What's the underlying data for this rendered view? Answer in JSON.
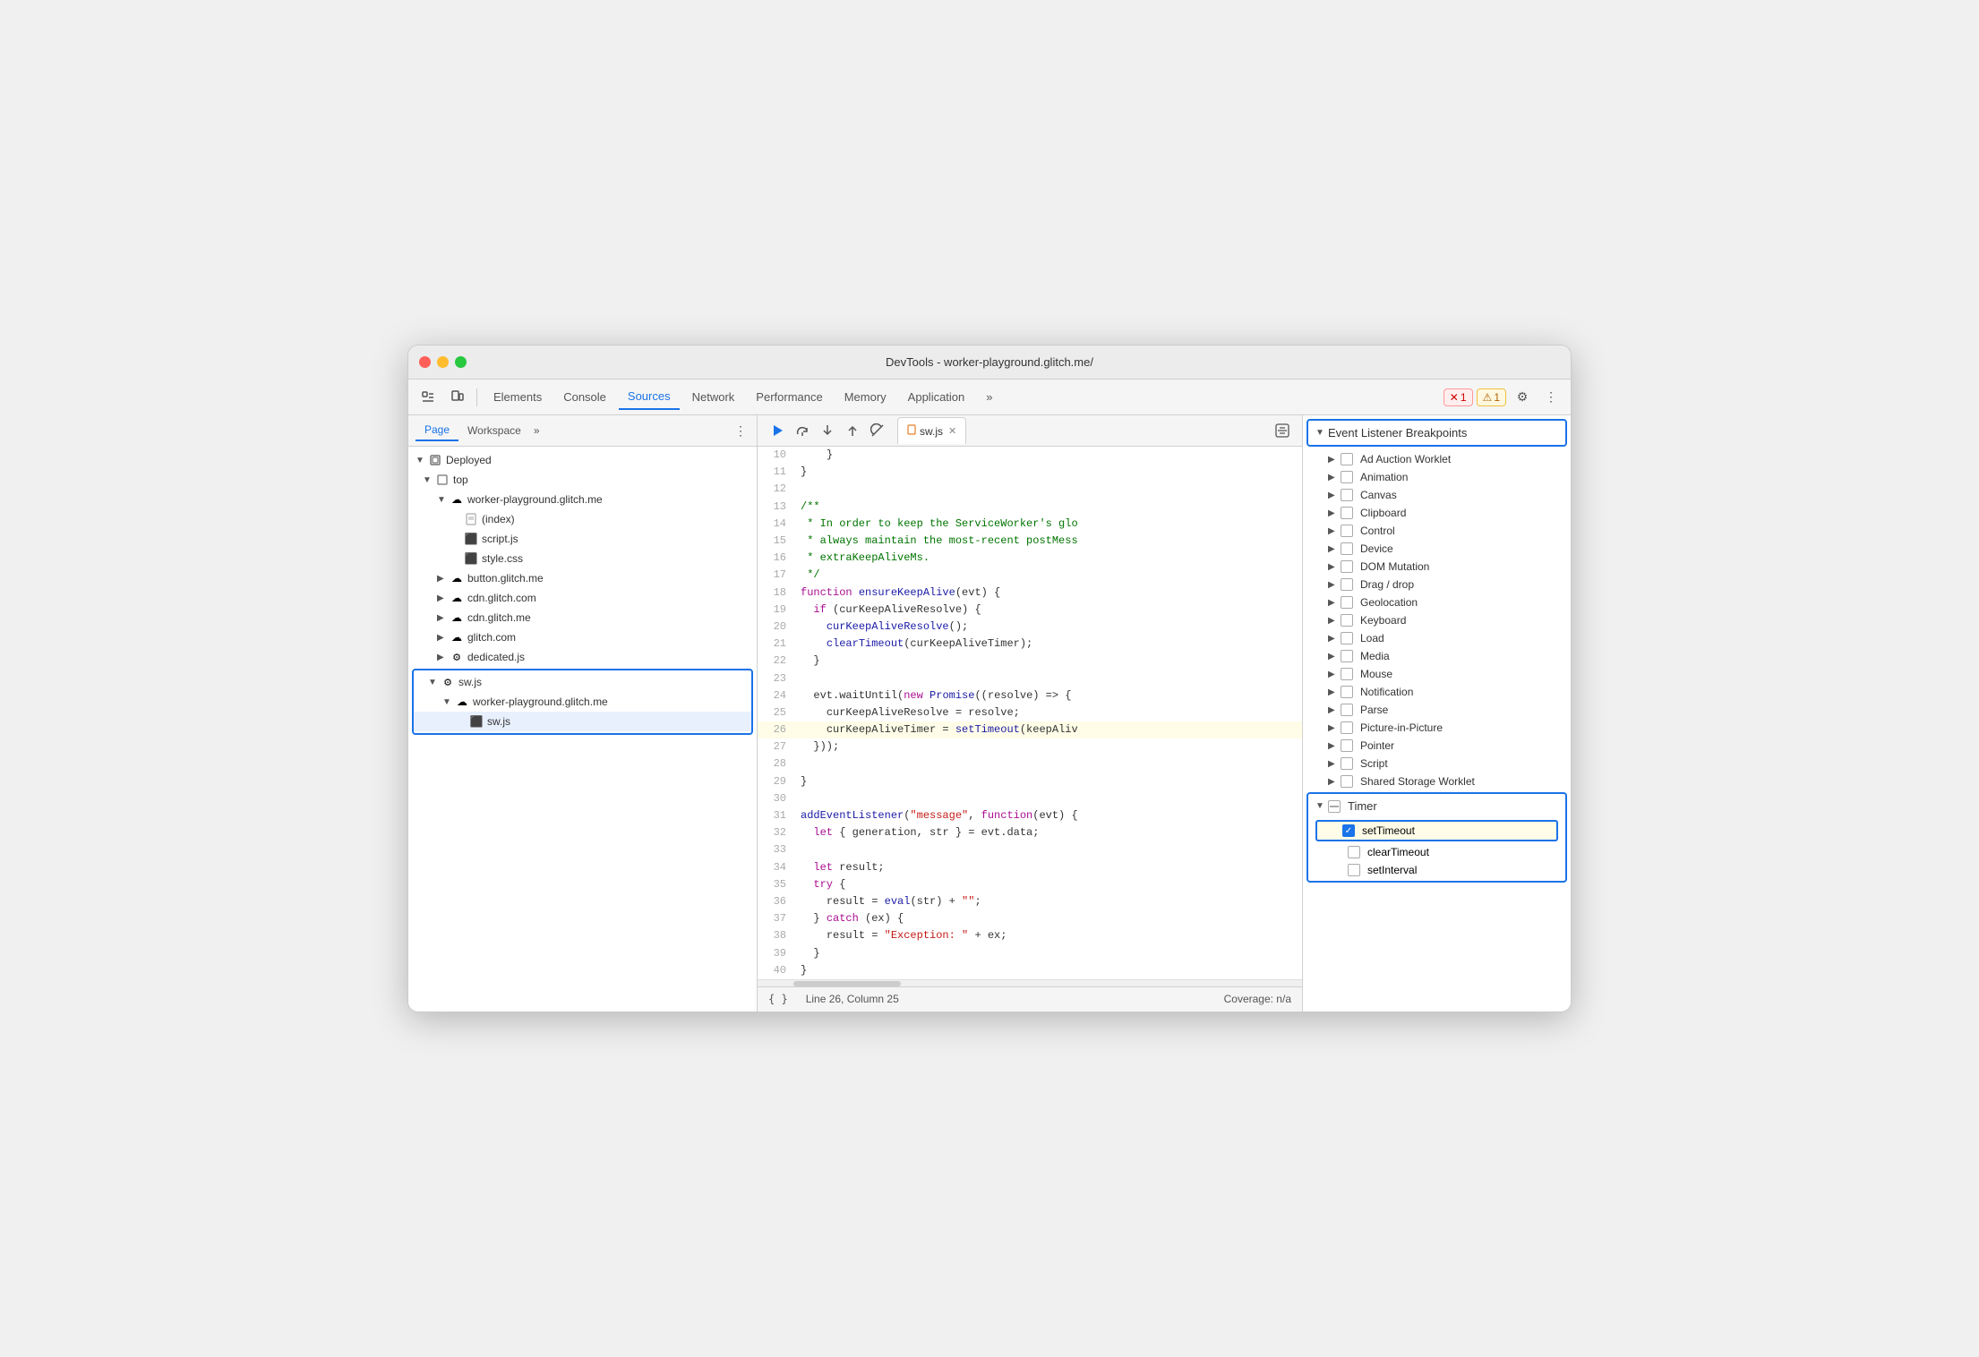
{
  "window": {
    "title": "DevTools - worker-playground.glitch.me/"
  },
  "toolbar": {
    "tabs": [
      "Elements",
      "Console",
      "Sources",
      "Network",
      "Performance",
      "Memory",
      "Application"
    ],
    "active_tab": "Sources",
    "more_icon": "»",
    "error_count": "1",
    "warn_count": "1"
  },
  "left_panel": {
    "tabs": [
      "Page",
      "Workspace"
    ],
    "more": "»",
    "active_tab": "Page",
    "tree": [
      {
        "label": "Deployed",
        "indent": 0,
        "arrow": "▼",
        "icon": "cube"
      },
      {
        "label": "top",
        "indent": 1,
        "arrow": "▼",
        "icon": "square"
      },
      {
        "label": "worker-playground.glitch.me",
        "indent": 2,
        "arrow": "▼",
        "icon": "cloud"
      },
      {
        "label": "(index)",
        "indent": 3,
        "arrow": "",
        "icon": "file"
      },
      {
        "label": "script.js",
        "indent": 3,
        "arrow": "",
        "icon": "file-js"
      },
      {
        "label": "style.css",
        "indent": 3,
        "arrow": "",
        "icon": "file-css"
      },
      {
        "label": "button.glitch.me",
        "indent": 2,
        "arrow": "▶",
        "icon": "cloud"
      },
      {
        "label": "cdn.glitch.com",
        "indent": 2,
        "arrow": "▶",
        "icon": "cloud"
      },
      {
        "label": "cdn.glitch.me",
        "indent": 2,
        "arrow": "▶",
        "icon": "cloud"
      },
      {
        "label": "glitch.com",
        "indent": 2,
        "arrow": "▶",
        "icon": "cloud"
      },
      {
        "label": "dedicated.js",
        "indent": 2,
        "arrow": "▶",
        "icon": "gear-file"
      },
      {
        "label": "sw.js",
        "indent": 1,
        "arrow": "▼",
        "icon": "gear"
      },
      {
        "label": "worker-playground.glitch.me",
        "indent": 2,
        "arrow": "▼",
        "icon": "cloud"
      },
      {
        "label": "sw.js",
        "indent": 3,
        "arrow": "",
        "icon": "file-orange"
      }
    ],
    "highlighted_range": [
      11,
      13
    ]
  },
  "editor": {
    "file_name": "sw.js",
    "lines": [
      {
        "num": 10,
        "code": "    }"
      },
      {
        "num": 11,
        "code": "}"
      },
      {
        "num": 12,
        "code": ""
      },
      {
        "num": 13,
        "code": "/**"
      },
      {
        "num": 14,
        "code": " * In order to keep the ServiceWorker's glo"
      },
      {
        "num": 15,
        "code": " * always maintain the most-recent postMess"
      },
      {
        "num": 16,
        "code": " * extraKeepAliveMs."
      },
      {
        "num": 17,
        "code": " */"
      },
      {
        "num": 18,
        "code": "function ensureKeepAlive(evt) {",
        "highlight_fn": true
      },
      {
        "num": 19,
        "code": "  if (curKeepAliveResolve) {",
        "highlight_kw": true
      },
      {
        "num": 20,
        "code": "    curKeepAliveResolve();"
      },
      {
        "num": 21,
        "code": "    clearTimeout(curKeepAliveTimer);"
      },
      {
        "num": 22,
        "code": "  }"
      },
      {
        "num": 23,
        "code": ""
      },
      {
        "num": 24,
        "code": "  evt.waitUntil(new Promise((resolve) => {"
      },
      {
        "num": 25,
        "code": "    curKeepAliveResolve = resolve;"
      },
      {
        "num": 26,
        "code": "    curKeepAliveTimer = setTimeout(keepAliv",
        "highlighted": true
      },
      {
        "num": 27,
        "code": "  }));"
      },
      {
        "num": 28,
        "code": ""
      },
      {
        "num": 29,
        "code": "}"
      },
      {
        "num": 30,
        "code": ""
      },
      {
        "num": 31,
        "code": "addEventListener(\"message\", function(evt) {"
      },
      {
        "num": 32,
        "code": "  let { generation, str } = evt.data;"
      },
      {
        "num": 33,
        "code": ""
      },
      {
        "num": 34,
        "code": "  let result;"
      },
      {
        "num": 35,
        "code": "  try {"
      },
      {
        "num": 36,
        "code": "    result = eval(str) + \"\";"
      },
      {
        "num": 37,
        "code": "  } catch (ex) {"
      },
      {
        "num": 38,
        "code": "    result = \"Exception: \" + ex;"
      },
      {
        "num": 39,
        "code": "  }"
      },
      {
        "num": 40,
        "code": "}"
      }
    ],
    "status": {
      "format_label": "{ }",
      "position": "Line 26, Column 25",
      "coverage": "Coverage: n/a"
    }
  },
  "right_panel": {
    "title": "Event Listener Breakpoints",
    "items": [
      {
        "label": "Ad Auction Worklet",
        "checked": false,
        "expandable": true
      },
      {
        "label": "Animation",
        "checked": false,
        "expandable": true
      },
      {
        "label": "Canvas",
        "checked": false,
        "expandable": true
      },
      {
        "label": "Clipboard",
        "checked": false,
        "expandable": true
      },
      {
        "label": "Control",
        "checked": false,
        "expandable": true
      },
      {
        "label": "Device",
        "checked": false,
        "expandable": true
      },
      {
        "label": "DOM Mutation",
        "checked": false,
        "expandable": true
      },
      {
        "label": "Drag / drop",
        "checked": false,
        "expandable": true
      },
      {
        "label": "Geolocation",
        "checked": false,
        "expandable": true
      },
      {
        "label": "Keyboard",
        "checked": false,
        "expandable": true
      },
      {
        "label": "Load",
        "checked": false,
        "expandable": true
      },
      {
        "label": "Media",
        "checked": false,
        "expandable": true
      },
      {
        "label": "Mouse",
        "checked": false,
        "expandable": true
      },
      {
        "label": "Notification",
        "checked": false,
        "expandable": true
      },
      {
        "label": "Parse",
        "checked": false,
        "expandable": true
      },
      {
        "label": "Picture-in-Picture",
        "checked": false,
        "expandable": true
      },
      {
        "label": "Pointer",
        "checked": false,
        "expandable": true
      },
      {
        "label": "Script",
        "checked": false,
        "expandable": true
      },
      {
        "label": "Shared Storage Worklet",
        "checked": false,
        "expandable": true
      }
    ],
    "timer_section": {
      "label": "Timer",
      "expanded": true,
      "children": [
        {
          "label": "setTimeout",
          "checked": true
        },
        {
          "label": "clearTimeout",
          "checked": false
        },
        {
          "label": "setInterval",
          "checked": false
        }
      ]
    }
  },
  "debugger_toolbar": {
    "resume": "▶",
    "step_over": "↺",
    "step_into": "↓",
    "step_out": "↑",
    "deactivate": "⊘"
  }
}
